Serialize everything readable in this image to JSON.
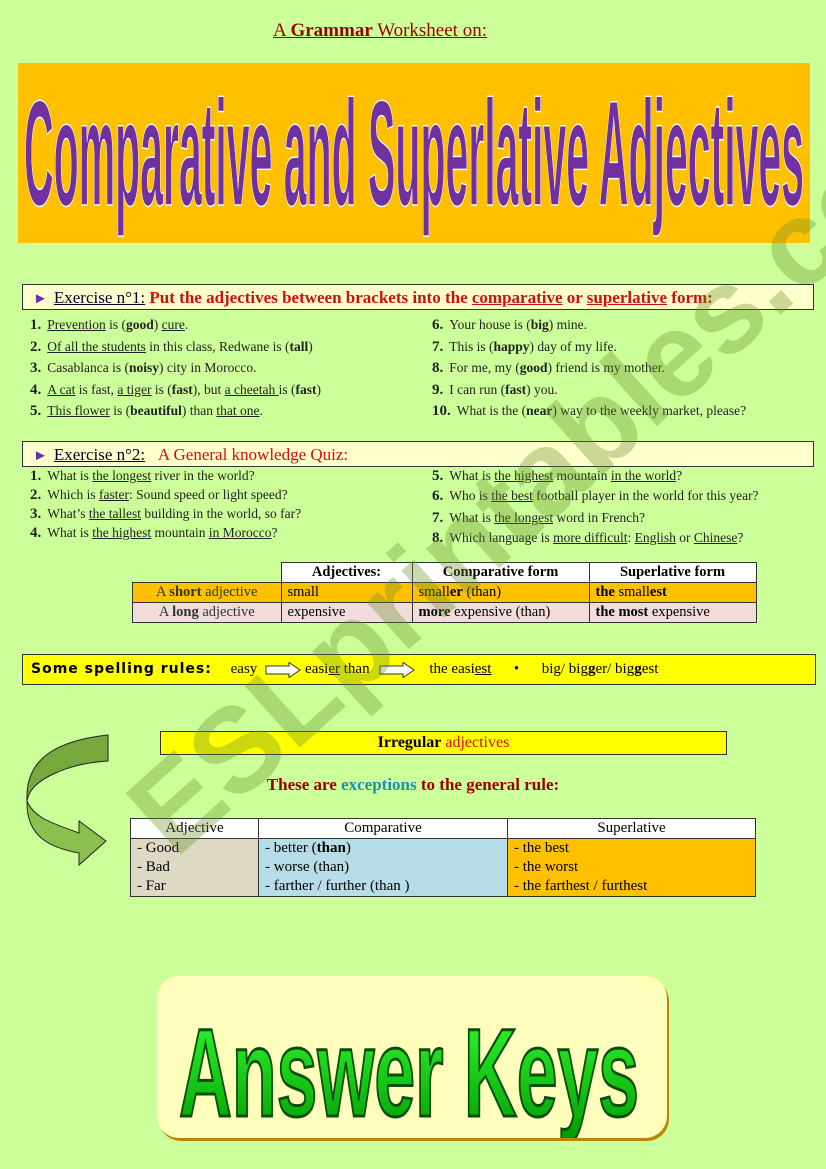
{
  "header": {
    "subtitle_prefix": "A ",
    "subtitle_bold": "Grammar",
    "subtitle_suffix": " Worksheet on:",
    "banner_title": "Comparative and Superlative Adjectives",
    "colors": {
      "banner_bg": "#ffc000",
      "banner_text": "#7030a0",
      "page_bg": "#ccff99"
    }
  },
  "exercise1": {
    "label": "Exercise n°1:",
    "instruction_part1": " Put the adjectives between brackets into the ",
    "instruction_comparative": "comparative",
    "instruction_or": " or ",
    "instruction_superlative": "superlative",
    "instruction_end": " form:",
    "items": [
      {
        "num": "1.",
        "parts": [
          [
            "u",
            "Prevention"
          ],
          [
            "t",
            " is ("
          ],
          [
            "b",
            "good"
          ],
          [
            "t",
            ") "
          ],
          [
            "u",
            "cure"
          ],
          [
            "t",
            "."
          ]
        ]
      },
      {
        "num": "2.",
        "parts": [
          [
            "u",
            "Of all the students"
          ],
          [
            "t",
            " in this class, Redwane is ("
          ],
          [
            "b",
            "tall"
          ],
          [
            "t",
            ")"
          ]
        ]
      },
      {
        "num": "3.",
        "parts": [
          [
            "t",
            "Casablanca is ("
          ],
          [
            "b",
            "noisy"
          ],
          [
            "t",
            ") city in Morocco."
          ]
        ]
      },
      {
        "num": "4.",
        "parts": [
          [
            "u",
            "A cat"
          ],
          [
            "t",
            " is fast, "
          ],
          [
            "u",
            "a tiger"
          ],
          [
            "t",
            " is ("
          ],
          [
            "b",
            "fast"
          ],
          [
            "t",
            "), but "
          ],
          [
            "u",
            "a cheetah "
          ],
          [
            "t",
            "is ("
          ],
          [
            "b",
            "fast"
          ],
          [
            "t",
            ")"
          ]
        ]
      },
      {
        "num": "5.",
        "parts": [
          [
            "u",
            "This flower"
          ],
          [
            "t",
            " is ("
          ],
          [
            "b",
            "beautiful"
          ],
          [
            "t",
            ") than "
          ],
          [
            "u",
            "that one"
          ],
          [
            "t",
            "."
          ]
        ]
      },
      {
        "num": "6.",
        "parts": [
          [
            "t",
            "Your house is ("
          ],
          [
            "b",
            "big"
          ],
          [
            "t",
            ") mine."
          ]
        ]
      },
      {
        "num": "7.",
        "parts": [
          [
            "t",
            "This is ("
          ],
          [
            "b",
            "happy"
          ],
          [
            "t",
            ") day of my life."
          ]
        ]
      },
      {
        "num": "8.",
        "parts": [
          [
            "t",
            "For me, my ("
          ],
          [
            "b",
            "good"
          ],
          [
            "t",
            ") friend is my mother."
          ]
        ]
      },
      {
        "num": "9.",
        "parts": [
          [
            "t",
            "I can run ("
          ],
          [
            "b",
            "fast"
          ],
          [
            "t",
            ") you."
          ]
        ]
      },
      {
        "num": "10.",
        "parts": [
          [
            "t",
            "What is the ("
          ],
          [
            "b",
            "near"
          ],
          [
            "t",
            ") way to the weekly market, please?"
          ]
        ]
      }
    ]
  },
  "exercise2": {
    "label": "Exercise n°2:",
    "title": "A General knowledge Quiz:",
    "items": [
      {
        "num": "1.",
        "parts": [
          [
            "t",
            "What is "
          ],
          [
            "u",
            "the longest"
          ],
          [
            "t",
            " river in the world?"
          ]
        ]
      },
      {
        "num": "2.",
        "parts": [
          [
            "t",
            "Which is "
          ],
          [
            "u",
            "faster"
          ],
          [
            "t",
            ": Sound speed or light speed?"
          ]
        ]
      },
      {
        "num": "3.",
        "parts": [
          [
            "t",
            "What’s "
          ],
          [
            "u",
            "the tallest"
          ],
          [
            "t",
            " building in the world, so far?"
          ]
        ]
      },
      {
        "num": "4.",
        "parts": [
          [
            "t",
            "What is "
          ],
          [
            "u",
            "the highest"
          ],
          [
            "t",
            " mountain "
          ],
          [
            "u",
            "in Morocco"
          ],
          [
            "t",
            "?"
          ]
        ]
      },
      {
        "num": "5.",
        "parts": [
          [
            "t",
            "What is "
          ],
          [
            "u",
            "the highest"
          ],
          [
            "t",
            " mountain "
          ],
          [
            "u",
            "in the world"
          ],
          [
            "t",
            "?"
          ]
        ]
      },
      {
        "num": "6.",
        "parts": [
          [
            "t",
            "Who is "
          ],
          [
            "u",
            "the best"
          ],
          [
            "t",
            " football player in the world for this year?"
          ]
        ]
      },
      {
        "num": "7.",
        "parts": [
          [
            "t",
            "What is "
          ],
          [
            "u",
            "the longest"
          ],
          [
            "t",
            " word in French?"
          ]
        ]
      },
      {
        "num": "8.",
        "parts": [
          [
            "t",
            "Which language is "
          ],
          [
            "u",
            "more difficult"
          ],
          [
            "t",
            ": "
          ],
          [
            "u",
            "English"
          ],
          [
            "t",
            " or "
          ],
          [
            "u",
            "Chinese"
          ],
          [
            "t",
            "?"
          ]
        ]
      }
    ]
  },
  "forms_table": {
    "headers": [
      "",
      "Adjectives:",
      "Comparative form",
      "Superlative form"
    ],
    "short_row": {
      "label_pre": "A ",
      "label_bold": "short",
      "label_post": " adjective",
      "adjective": "small",
      "comp_pre": "small",
      "comp_bold": "er",
      "comp_post": " (than)",
      "sup_bold1": "the",
      "sup_mid": " small",
      "sup_bold2": "est"
    },
    "long_row": {
      "label_pre": "A ",
      "label_bold": "long",
      "label_post": " adjective",
      "adjective": "expensive",
      "comp_bold": "more",
      "comp_post": " expensive (than)",
      "sup_bold": "the most",
      "sup_post": "  expensive"
    }
  },
  "spelling": {
    "label": "Some spelling rules:",
    "easy": "easy",
    "easier_pre": "easi",
    "easier_u": "er",
    "easier_post": " than",
    "easiest_pre": "the easi",
    "easiest_u": "est",
    "bullet": "•",
    "big_rule_1": "big/ big",
    "big_rule_g1": "g",
    "big_rule_2": "er/ big",
    "big_rule_g2": "g",
    "big_rule_3": "est"
  },
  "irregular": {
    "heading_black": "Irregular",
    "heading_red": " adjectives",
    "sub_pre": "These are ",
    "sub_teal": "exceptions",
    "sub_post": " to the general rule:",
    "headers": [
      "Adjective",
      "Comparative",
      "Superlative"
    ],
    "adjectives": [
      "- Good",
      "- Bad",
      "- Far"
    ],
    "comparatives": [
      {
        "pre": "- better  (",
        "bold": "than",
        "post": ")"
      },
      {
        "pre": "- worse (than)",
        "bold": "",
        "post": ""
      },
      {
        "pre": "- farther  /  further  (than  )",
        "bold": "",
        "post": ""
      }
    ],
    "superlatives": [
      "- the best",
      "- the worst",
      "- the farthest   /  furthest"
    ]
  },
  "answer_keys": {
    "title": "Answer Keys"
  },
  "watermark": {
    "text": "ESLprintables.com"
  }
}
